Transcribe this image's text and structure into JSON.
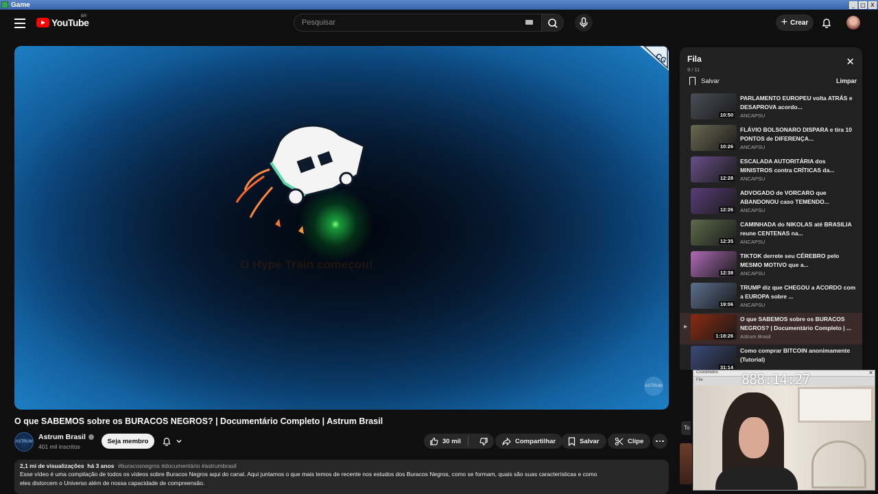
{
  "os": {
    "title": "Game",
    "controls": [
      "_",
      "□",
      "X"
    ]
  },
  "header": {
    "logo_text": "YouTube",
    "country": "BR",
    "search_placeholder": "Pesquisar",
    "create_label": "Crear"
  },
  "player": {
    "overlay_text": "O Hype Train começou!",
    "corner_badge": "CG",
    "watermark": "ASTRUM"
  },
  "video": {
    "title": "O que SABEMOS sobre os BURACOS NEGROS? | Documentário Completo | Astrum Brasil",
    "channel": "Astrum Brasil",
    "channel_avatar_text": "ASTRUM",
    "subscribers": "401 mil inscritos",
    "member_label": "Seja membro",
    "likes": "30 mil",
    "share_label": "Compartilhar",
    "save_label": "Salvar",
    "clip_label": "Clipe"
  },
  "description": {
    "views": "2,1 mi de visualizações",
    "age": "há 3 anos",
    "tags": "#buracosnegros #documentário #astrumbrasil",
    "line1": "Esse vídeo é uma compilação de todos os vídeos sobre Buracos Negros aqui do canal. Aqui juntamos o que mais temos de recente nos estudos dos Buracos Negros, como se formam, quais são suas características e como",
    "line2": "eles distorcem o Universo além de nossa capacidade de compreensão."
  },
  "queue": {
    "title": "Fila",
    "count": "9 / 11",
    "save_label": "Salvar",
    "clear_label": "Limpar",
    "items": [
      {
        "title": "PARLAMENTO EUROPEU volta ATRÁS e DESAPROVA acordo...",
        "channel": "ANCAPSU",
        "duration": "10:50",
        "thumb": "#4b4e57"
      },
      {
        "title": "FLÁVIO BOLSONARO DISPARA e tira 10 PONTOS de DIFERENÇA...",
        "channel": "ANCAPSU",
        "duration": "10:26",
        "thumb": "#6b6a52"
      },
      {
        "title": "ESCALADA AUTORITÁRIA dos MINISTROS contra CRÍTICAS da...",
        "channel": "ANCAPSU",
        "duration": "12:28",
        "thumb": "#6a4f8a"
      },
      {
        "title": "ADVOGADO de VORCARO que ABANDONOU caso TEMENDO...",
        "channel": "ANCAPSU",
        "duration": "12:26",
        "thumb": "#5a3d7a"
      },
      {
        "title": "CAMINHADA do NIKOLAS até BRASILIA reune CENTENAS na...",
        "channel": "ANCAPSU",
        "duration": "12:35",
        "thumb": "#5d6b4a"
      },
      {
        "title": "TIKTOK derrete seu CÉREBRO pelo MESMO MOTIVO que a...",
        "channel": "ANCAPSU",
        "duration": "12:38",
        "thumb": "#b06ab8"
      },
      {
        "title": "TRUMP diz que CHEGOU a ACORDO com a EUROPA sobre ...",
        "channel": "ANCAPSU",
        "duration": "19:06",
        "thumb": "#5b6f8f"
      },
      {
        "title": "O que SABEMOS sobre os BURACOS NEGROS? | Documentário Completo | ...",
        "channel": "Astrum Brasil",
        "duration": "1:18:26",
        "thumb": "#8a2a10",
        "current": true
      },
      {
        "title": "Como comprar BITCOIN anonimamente (Tutorial)",
        "channel": "",
        "duration": "31:14",
        "thumb": "#3a4a7a"
      }
    ]
  },
  "webcam": {
    "window_label": "Cronômetro",
    "menu": "File",
    "timer": "888:14:27"
  },
  "side_peek": "To"
}
